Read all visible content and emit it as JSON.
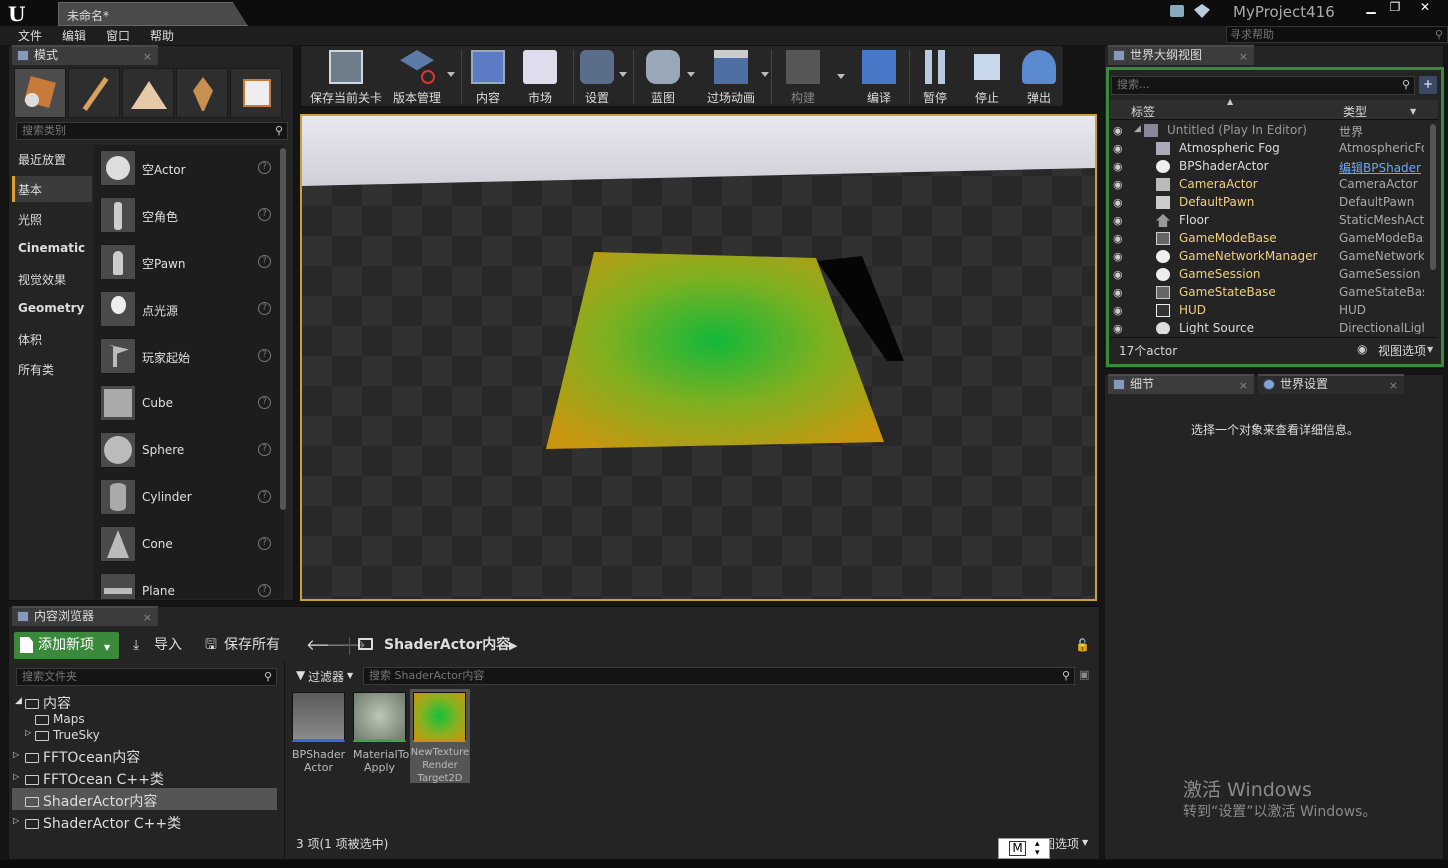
{
  "window": {
    "doc_tab": "未命名*",
    "project": "MyProject416",
    "help_search_placeholder": "寻求帮助",
    "menu": [
      "文件",
      "编辑",
      "窗口",
      "帮助"
    ]
  },
  "modes": {
    "tab_title": "模式",
    "search_placeholder": "搜索类别",
    "categories": [
      "最近放置",
      "基本",
      "光照",
      "Cinematic",
      "视觉效果",
      "Geometry",
      "体积",
      "所有类"
    ],
    "items": [
      "空Actor",
      "空角色",
      "空Pawn",
      "点光源",
      "玩家起始",
      "Cube",
      "Sphere",
      "Cylinder",
      "Cone",
      "Plane"
    ]
  },
  "toolbar": {
    "buttons": [
      "保存当前关卡",
      "版本管理",
      "内容",
      "市场",
      "设置",
      "蓝图",
      "过场动画",
      "构建",
      "编译",
      "暂停",
      "停止",
      "弹出"
    ]
  },
  "outliner": {
    "tab_title": "世界大纲视图",
    "search_placeholder": "搜索...",
    "col_label": "标签",
    "col_type": "类型",
    "rows": [
      {
        "name": "Untitled (Play In Editor)",
        "type": "世界"
      },
      {
        "name": "Atmospheric Fog",
        "type": "AtmosphericFog"
      },
      {
        "name": "BPShaderActor",
        "type": "编辑BPShader"
      },
      {
        "name": "CameraActor",
        "type": "CameraActor"
      },
      {
        "name": "DefaultPawn",
        "type": "DefaultPawn"
      },
      {
        "name": "Floor",
        "type": "StaticMeshActo"
      },
      {
        "name": "GameModeBase",
        "type": "GameModeBase"
      },
      {
        "name": "GameNetworkManager",
        "type": "GameNetworkM"
      },
      {
        "name": "GameSession",
        "type": "GameSession"
      },
      {
        "name": "GameStateBase",
        "type": "GameStateBase"
      },
      {
        "name": "HUD",
        "type": "HUD"
      },
      {
        "name": "Light Source",
        "type": "DirectionalLight"
      }
    ],
    "count": "17个actor",
    "view_options": "视图选项"
  },
  "details": {
    "tab_title": "细节",
    "world_tab_title": "世界设置",
    "empty_msg": "选择一个对象来查看详细信息。"
  },
  "content_browser": {
    "tab_title": "内容浏览器",
    "add_new": "添加新项",
    "import": "导入",
    "save_all": "保存所有",
    "path": "ShaderActor内容",
    "folder_search": "搜索文件夹",
    "filters": "过滤器",
    "asset_search": "搜索 ShaderActor内容",
    "tree": [
      "内容",
      "Maps",
      "TrueSky",
      "FFTOcean内容",
      "FFTOcean C++类",
      "ShaderActor内容",
      "ShaderActor C++类"
    ],
    "assets": [
      {
        "name": "BPShader Actor"
      },
      {
        "name": "MaterialTo Apply"
      },
      {
        "name": "NewTexture Render Target2D"
      }
    ],
    "status": "3 项(1 项被选中)",
    "view_options": "视图选项",
    "ime": "M"
  },
  "watermark": {
    "line1": "激活 Windows",
    "line2": "转到“设置”以激活 Windows。"
  },
  "colors": {
    "accent": "#e0a030",
    "highlight": "#3a8a3a",
    "link": "#6aa8ff"
  }
}
